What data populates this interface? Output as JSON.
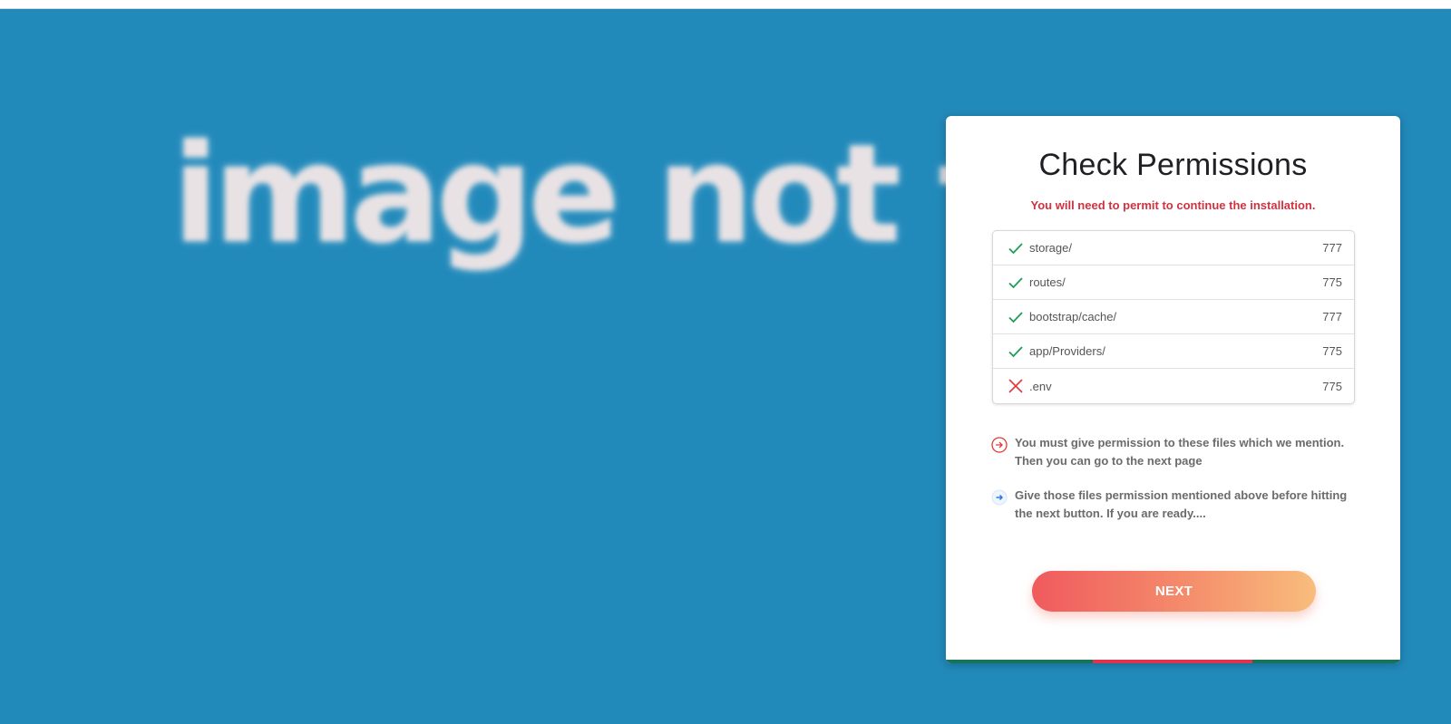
{
  "background": {
    "placeholder_text": "image not f",
    "color": "#228abb"
  },
  "card": {
    "title": "Check Permissions",
    "subtitle": "You will need to permit to continue the installation.",
    "permissions": [
      {
        "name": "storage/",
        "value": "777",
        "status": "ok",
        "icon": "check-icon"
      },
      {
        "name": "routes/",
        "value": "775",
        "status": "ok",
        "icon": "check-icon"
      },
      {
        "name": "bootstrap/cache/",
        "value": "777",
        "status": "ok",
        "icon": "check-icon"
      },
      {
        "name": "app/Providers/",
        "value": "775",
        "status": "ok",
        "icon": "check-icon"
      },
      {
        "name": ".env",
        "value": "775",
        "status": "fail",
        "icon": "cross-icon"
      }
    ],
    "notes": [
      {
        "text": "You must give permission to these files which we mention. Then you can go to the next page",
        "icon": "circle-arrow-right-icon"
      },
      {
        "text": "Give those files permission mentioned above before hitting the next button. If you are ready....",
        "icon": "arrow-right-icon"
      }
    ],
    "next_label": "NEXT"
  },
  "colors": {
    "ok": "#1f9d55",
    "fail": "#e03a3a",
    "accent_red": "#d0323f",
    "note_blue": "#2a7de1"
  }
}
